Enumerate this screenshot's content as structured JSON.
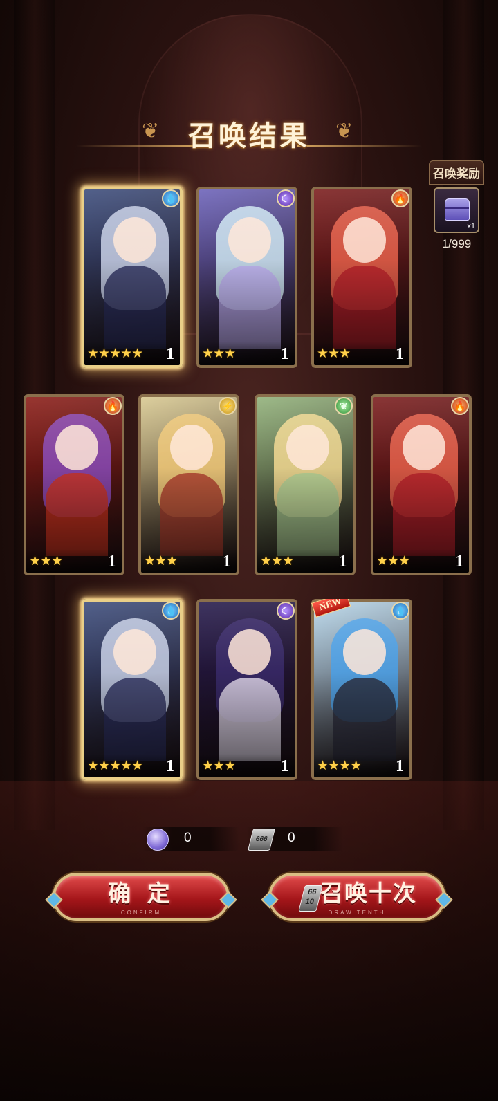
{
  "title": "召唤结果",
  "reward": {
    "title": "召唤奖励",
    "qty": "x1",
    "count": "1/999"
  },
  "cards": [
    {
      "element": "water",
      "element_icon": "water-drop-icon",
      "stars": 5,
      "star_text": "★★★★★",
      "count": "1",
      "glow": true,
      "is_new": false,
      "hair": "#c8d0e6",
      "body": "#2a2d5a",
      "bg": "#3a4a7a"
    },
    {
      "element": "moon",
      "element_icon": "moon-icon",
      "stars": 3,
      "star_text": "★★★",
      "count": "1",
      "glow": false,
      "is_new": false,
      "hair": "#cfe8f2",
      "body": "#b8a8e8",
      "bg": "#6a60b8"
    },
    {
      "element": "fire",
      "element_icon": "flame-icon",
      "stars": 3,
      "star_text": "★★★",
      "count": "1",
      "glow": false,
      "is_new": false,
      "hair": "#e8604a",
      "body": "#b01e28",
      "bg": "#7a1a1a"
    },
    {
      "element": "fire",
      "element_icon": "flame-icon",
      "stars": 3,
      "star_text": "★★★",
      "count": "1",
      "glow": false,
      "is_new": false,
      "hair": "#8a4ab8",
      "body": "#c8321e",
      "bg": "#8a1a14"
    },
    {
      "element": "thunder",
      "element_icon": "lightning-icon",
      "stars": 3,
      "star_text": "★★★",
      "count": "1",
      "glow": false,
      "is_new": false,
      "hair": "#f0c878",
      "body": "#a83a2a",
      "bg": "#d8c890"
    },
    {
      "element": "wind",
      "element_icon": "leaf-icon",
      "stars": 3,
      "star_text": "★★★",
      "count": "1",
      "glow": false,
      "is_new": false,
      "hair": "#f2d890",
      "body": "#a8c890",
      "bg": "#90b078"
    },
    {
      "element": "fire",
      "element_icon": "flame-icon",
      "stars": 3,
      "star_text": "★★★",
      "count": "1",
      "glow": false,
      "is_new": false,
      "hair": "#e8604a",
      "body": "#b01e28",
      "bg": "#7a1a1a"
    },
    {
      "element": "water",
      "element_icon": "water-drop-icon",
      "stars": 5,
      "star_text": "★★★★★",
      "count": "1",
      "glow": true,
      "is_new": false,
      "hair": "#c8d0e6",
      "body": "#2a2d5a",
      "bg": "#3a4a7a"
    },
    {
      "element": "moon",
      "element_icon": "moon-icon",
      "stars": 3,
      "star_text": "★★★",
      "count": "1",
      "glow": false,
      "is_new": false,
      "hair": "#3a2a6a",
      "body": "#e8e0f0",
      "bg": "#24184a"
    },
    {
      "element": "water",
      "element_icon": "water-drop-icon",
      "stars": 4,
      "star_text": "★★★★",
      "count": "1",
      "glow": false,
      "is_new": true,
      "new_label": "NEW",
      "hair": "#4aa0e8",
      "body": "#2a2a3a",
      "bg": "#b8d8ec"
    }
  ],
  "currency": [
    {
      "icon": "gem-icon",
      "value": "0"
    },
    {
      "icon": "ticket-icon",
      "ticket_text": "666",
      "value": "0"
    }
  ],
  "buttons": {
    "confirm": {
      "label": "确 定",
      "sub": "CONFIRM"
    },
    "draw_ten": {
      "label": "召唤十次",
      "sub": "DRAW TENTH",
      "ticket_top": "66",
      "ticket_bottom": "10"
    }
  }
}
